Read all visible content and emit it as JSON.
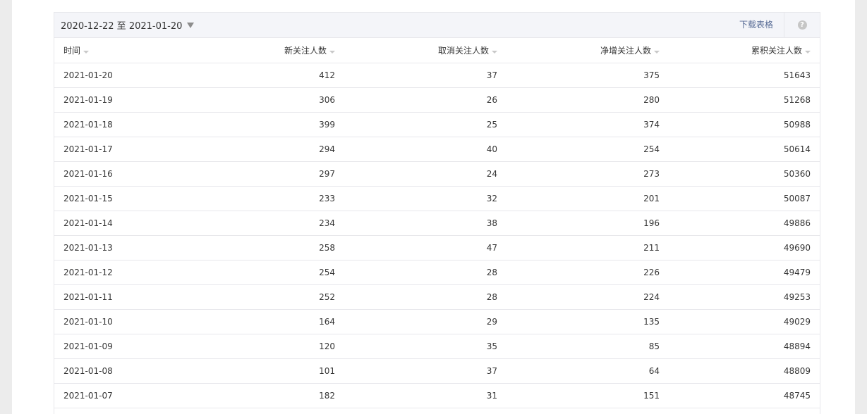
{
  "toolbar": {
    "date_range": "2020-12-22 至 2021-01-20",
    "download_label": "下载表格",
    "help_symbol": "?"
  },
  "table": {
    "headers": [
      "时间",
      "新关注人数",
      "取消关注人数",
      "净增关注人数",
      "累积关注人数"
    ],
    "rows": [
      [
        "2021-01-20",
        "412",
        "37",
        "375",
        "51643"
      ],
      [
        "2021-01-19",
        "306",
        "26",
        "280",
        "51268"
      ],
      [
        "2021-01-18",
        "399",
        "25",
        "374",
        "50988"
      ],
      [
        "2021-01-17",
        "294",
        "40",
        "254",
        "50614"
      ],
      [
        "2021-01-16",
        "297",
        "24",
        "273",
        "50360"
      ],
      [
        "2021-01-15",
        "233",
        "32",
        "201",
        "50087"
      ],
      [
        "2021-01-14",
        "234",
        "38",
        "196",
        "49886"
      ],
      [
        "2021-01-13",
        "258",
        "47",
        "211",
        "49690"
      ],
      [
        "2021-01-12",
        "254",
        "28",
        "226",
        "49479"
      ],
      [
        "2021-01-11",
        "252",
        "28",
        "224",
        "49253"
      ],
      [
        "2021-01-10",
        "164",
        "29",
        "135",
        "49029"
      ],
      [
        "2021-01-09",
        "120",
        "35",
        "85",
        "48894"
      ],
      [
        "2021-01-08",
        "101",
        "37",
        "64",
        "48809"
      ],
      [
        "2021-01-07",
        "182",
        "31",
        "151",
        "48745"
      ]
    ]
  },
  "colors": {
    "toolbar_bg": "#f4f5f9",
    "link": "#576b95",
    "border": "#e7e7eb"
  }
}
